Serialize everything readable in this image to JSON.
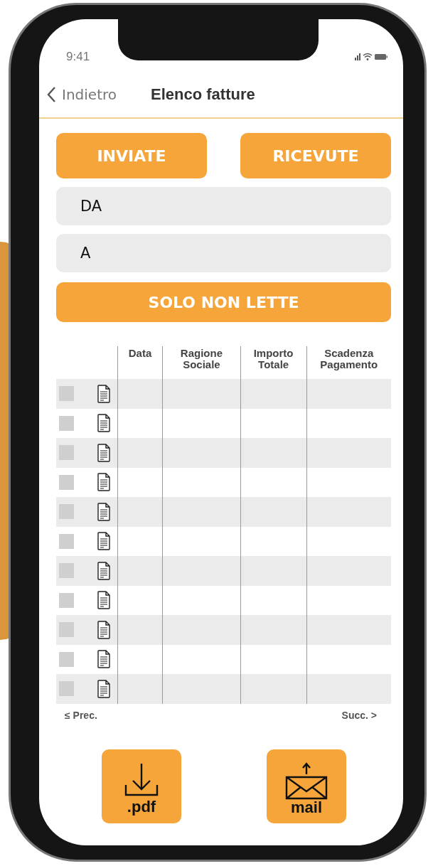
{
  "status_bar": {
    "time": "9:41"
  },
  "nav": {
    "back": "Indietro",
    "title": "Elenco fatture"
  },
  "tabs": [
    {
      "label": "INVIATE",
      "selected": false
    },
    {
      "label": "RICEVUTE",
      "selected": false
    }
  ],
  "filters": [
    {
      "value": "DA"
    },
    {
      "value": "A"
    }
  ],
  "unread_button": "SOLO NON LETTE",
  "table": {
    "columns": [
      "Data",
      "Ragione Sociale",
      "Importo Totale",
      "Scadenza Pagamento"
    ],
    "rows": [
      {
        "checked": false
      },
      {
        "checked": false
      },
      {
        "checked": false
      },
      {
        "checked": false
      },
      {
        "checked": false
      },
      {
        "checked": false
      },
      {
        "checked": false
      },
      {
        "checked": false
      },
      {
        "checked": false
      },
      {
        "checked": false
      },
      {
        "checked": false
      }
    ]
  },
  "pagination": {
    "previous": "≤ Prec.",
    "next": "Succ. >"
  },
  "actions": [
    {
      "kind": "pdf",
      "label": ".pdf"
    },
    {
      "kind": "mail",
      "label": "mail"
    }
  ]
}
